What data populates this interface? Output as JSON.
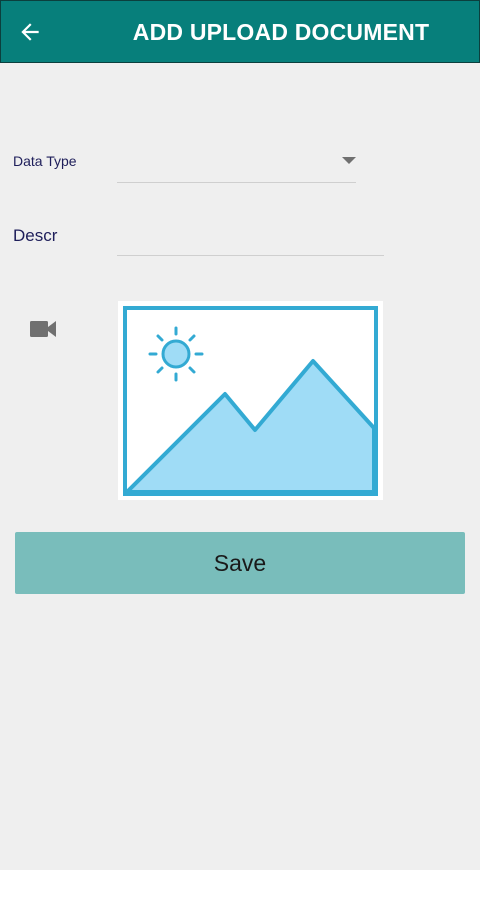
{
  "appbar": {
    "title": "ADD UPLOAD DOCUMENT",
    "back_icon": "arrow-left-icon",
    "background_color": "#077f7b"
  },
  "form": {
    "data_type": {
      "label": "Data Type",
      "selected_value": ""
    },
    "description": {
      "label": "Descr",
      "value": "",
      "placeholder": ""
    },
    "media": {
      "video_icon": "videocam-icon",
      "image_placeholder_icon": "image-placeholder-icon"
    }
  },
  "actions": {
    "save_label": "Save",
    "save_color": "#79bdbb"
  }
}
